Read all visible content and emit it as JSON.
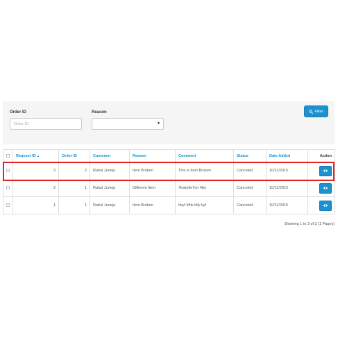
{
  "filter": {
    "order_id_label": "Order ID",
    "order_id_placeholder": "Order ID",
    "order_id_value": "",
    "reason_label": "Reason",
    "reason_selected": "",
    "button_label": "Filter",
    "button_icon": "search-icon"
  },
  "table": {
    "columns": {
      "request_id": "Requset ID",
      "order_id": "Order ID",
      "customer": "Customer",
      "reason": "Reason",
      "comment": "Comment",
      "status": "Status",
      "date_added": "Date Added",
      "action": "Action"
    },
    "sort_indicator": "▲",
    "rows": [
      {
        "request_id": "3",
        "order_id": "2",
        "customer": "Rahul Juneja",
        "reason": "Item Broken",
        "comment": "This is Item Broken",
        "status": "Canceled",
        "date_added": "10/11/2015",
        "action_icon": "eye-icon",
        "highlighted": true
      },
      {
        "request_id": "2",
        "order_id": "1",
        "customer": "Rahul Juneja",
        "reason": "Different Item",
        "comment": "7kaityfie7on 4bo",
        "status": "Canceled",
        "date_added": "10/11/2015",
        "action_icon": "eye-icon",
        "highlighted": false
      },
      {
        "request_id": "1",
        "order_id": "1",
        "customer": "Rahul Juneja",
        "reason": "Item Broken",
        "comment": "hkyf kfhk klfy kyf",
        "status": "Canceled",
        "date_added": "10/11/2015",
        "action_icon": "eye-icon",
        "highlighted": false
      }
    ]
  },
  "pagination": {
    "info": "Showing 1 to 3 of 3 (1 Pages)"
  },
  "colors": {
    "accent": "#1e91cf",
    "highlight_border": "#e02424",
    "panel_bg": "#f5f5f5"
  }
}
